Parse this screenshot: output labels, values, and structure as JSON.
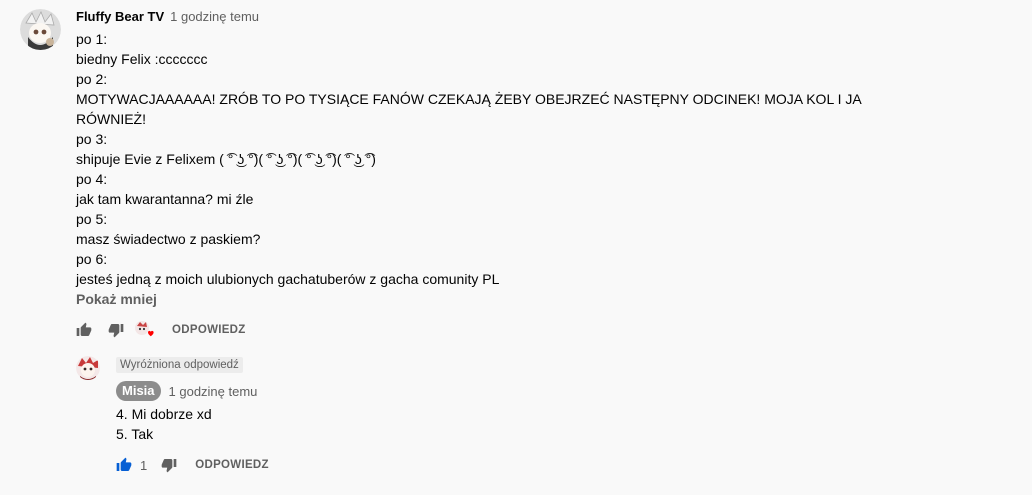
{
  "comment": {
    "author": "Fluffy Bear TV",
    "time": "1 godzinę temu",
    "lines": [
      "po 1:",
      "biedny Felix :ccccccc",
      "po 2:",
      "MOTYWACJAAAAAA! ZRÓB TO PO TYSIĄCE FANÓW CZEKAJĄ ŻEBY OBEJRZEĆ NASTĘPNY ODCINEK! MOJA KOL I JA",
      "RÓWNIEŻ!",
      "po 3:",
      "shipuje Evie z Felixem ( ͡° ͜ʖ ͡°)( ͡° ͜ʖ ͡°)( ͡° ͜ʖ ͡°)( ͡° ͜ʖ ͡°)",
      "po 4:",
      "jak tam kwarantanna? mi źle",
      "po 5:",
      "masz świadectwo z paskiem?",
      "po 6:",
      "jesteś jedną z moich ulubionych gachatuberów z gacha comunity PL"
    ],
    "show_less": "Pokaż mniej",
    "reply_label": "ODPOWIEDZ",
    "icons": {
      "like": "thumb-up-icon",
      "dislike": "thumb-down-icon",
      "heart": "creator-heart-icon"
    }
  },
  "reply": {
    "badge": "Wyróżniona odpowiedź",
    "author": "Misia",
    "time": "1 godzinę temu",
    "lines": [
      "4. Mi dobrze xd",
      "5. Tak"
    ],
    "like_count": "1",
    "reply_label": "ODPOWIEDZ"
  },
  "colors": {
    "background": "#f9f9f9",
    "secondary_text": "#606060",
    "like_active": "#065fd4",
    "heart": "#ff0000",
    "author_chip": "#8c8c8c"
  }
}
